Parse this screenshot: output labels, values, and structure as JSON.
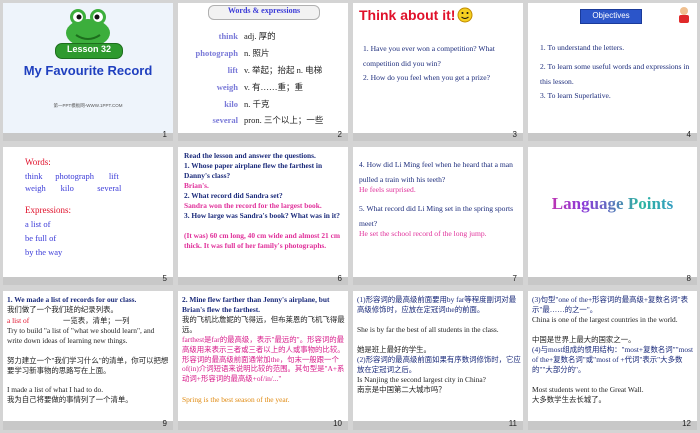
{
  "slides": [
    {
      "num": "1",
      "badge": "Lesson 32",
      "title": "My Favourite Record",
      "footer": "第一PPT模板网-WWW.1PPT.COM"
    },
    {
      "num": "2",
      "header": "Words & expressions",
      "words": [
        {
          "w": "think",
          "d": "adj. 厚的"
        },
        {
          "w": "photograph",
          "d": "n. 照片"
        },
        {
          "w": "lift",
          "d": "v. 举起；抬起 n. 电梯"
        },
        {
          "w": "weigh",
          "d": "v. 有……重；重"
        },
        {
          "w": "kilo",
          "d": "n. 千克"
        },
        {
          "w": "several",
          "d": "pron. 三个以上；一些"
        }
      ]
    },
    {
      "num": "3",
      "title": "Think about it!",
      "q1": "1. Have you ever won a competition? What competition did you win?",
      "q2": "2. How do you feel when you get a prize?"
    },
    {
      "num": "4",
      "header": "Objectives",
      "items": [
        "1. To understand the letters.",
        "2. To learn some useful words and expressions in this lesson.",
        "3. To learn Superlative."
      ]
    },
    {
      "num": "5",
      "words_label": "Words:",
      "words_line1": "think      photograph       lift",
      "words_line2": "weigh       kilo           several",
      "expr_label": "Expressions:",
      "expr": [
        "a list of",
        "be full of",
        "by the way"
      ]
    },
    {
      "num": "6",
      "head": "Read the lesson and answer the questions.",
      "q1": "1. Whose paper airplane flew the farthest in Danny's class?",
      "a1": "Brian's.",
      "q2": "2. What record did Sandra set?",
      "a2": "Sandra won the record for the largest book.",
      "q3": "3. How large was Sandra's book? What was in it?",
      "a3": "(It was) 60 cm long, 40 cm wide and almost 21 cm thick. It was full of her family's photographs."
    },
    {
      "num": "7",
      "q1": "4. How did Li Ming feel when he heard that a man pulled a train with his teeth?",
      "a1": "He feels surprised.",
      "q2": "5. What record did Li Ming set in the spring sports meet?",
      "a2": "He set the school record of the long jump."
    },
    {
      "num": "8",
      "title": "Language Points"
    },
    {
      "num": "9",
      "l1": "1. We made a list of records for our class.",
      "l2": "我们做了一个我们班的纪录列表。",
      "l3a": "a list of",
      "l3b": "一览表，清单；一列",
      "l4": "Try to build \"a list of \"what we should learn\", and write down ideas of learning new things.",
      "l5": "努力建立一个\"我们学习什么\"的清单，你可以把想要学习新事物的思路写在上面。",
      "l6": "I made a list of what I had to do.",
      "l7": "我为自己将要做的事情列了一个清单。"
    },
    {
      "num": "10",
      "l1": "2. Mine flew farther than Jenny's airplane, but Brian's flew the farthest.",
      "l2": "我的飞机比詹妮的飞得远，但布莱恩的飞机飞得最远。",
      "l3": "farthest是far的最高级，表示\"最远的\"。形容词的最高级用来表示三者或三者以上的人或事物的比较。形容词的最高级前面通常加the，句末一般跟一个of(in)介词短语来说明比较的范围。其句型是\"A+系动词+形容词的最高级+of/in/...\"",
      "l4": "Spring is the best season of the year."
    },
    {
      "num": "11",
      "l1": "(1)形容词的最高级前面要用by far等程度副词对最高级修饰时，应放在定冠词the的前面。",
      "l2": "She is by far the best of all students in the class.",
      "l3": "她是班上最好的学生。",
      "l4": "(2)形容词的最高级前面如果有序数词修饰时，它应放在定冠词之后。",
      "l5": "Is Nanjing the second largest city in China?",
      "l6": "南京是中国第二大城市吗？"
    },
    {
      "num": "12",
      "l1": "(3)句型\"one of the+形容词的最高级+复数名词\"表示\"最……的之一\"。",
      "l2": "China is one of the largest countries in the world.",
      "l3": "中国是世界上最大的国家之一。",
      "l4": "(4)与most组成的惯用结构：\"most+复数名词\"\"most of the+复数名词\"或\"most of +代词\"表示\"大多数的\"\"大部分的\"。",
      "l5": "Most students went to the Great Wall.",
      "l6": "大多数学生去长城了。"
    }
  ]
}
